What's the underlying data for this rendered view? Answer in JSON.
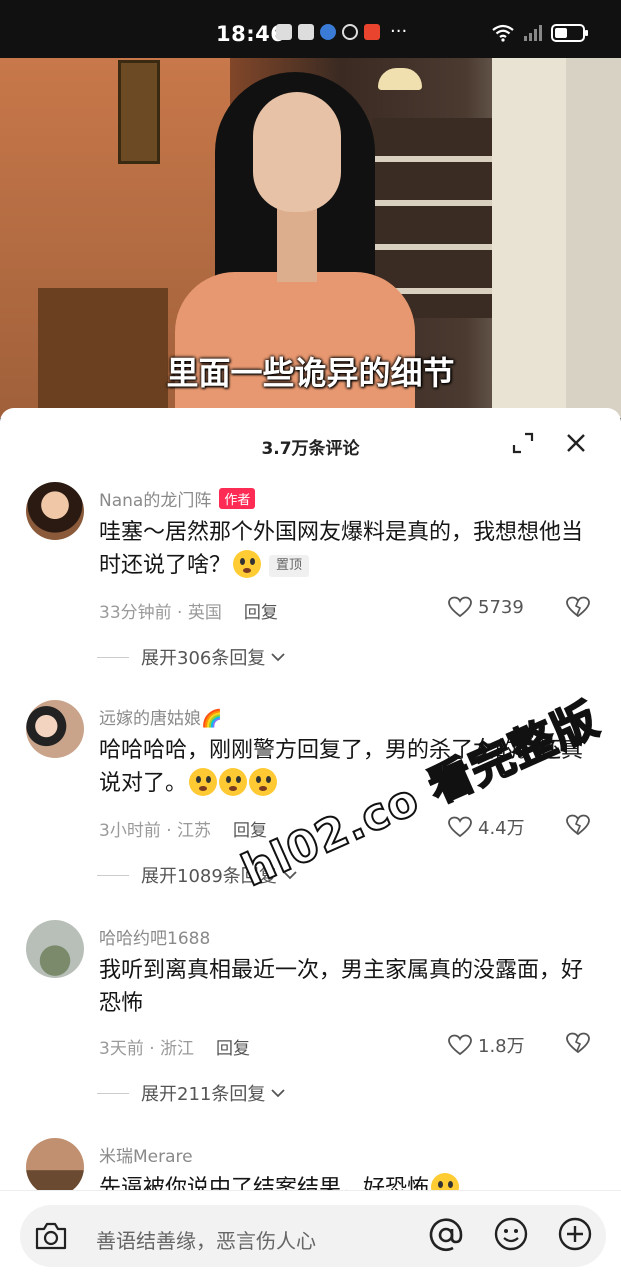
{
  "status_bar": {
    "time": "18:46",
    "more": "···"
  },
  "video": {
    "subtitle": "里面一些诡异的细节"
  },
  "sheet": {
    "title": "3.7万条评论"
  },
  "comments": [
    {
      "username": "Nana的龙门阵",
      "badge": "作者",
      "text": "哇塞～居然那个外国网友爆料是真的，我想想他当时还说了啥？",
      "pin": "置顶",
      "time_location": "33分钟前 · 英国",
      "reply": "回复",
      "likes": "5739",
      "expand": "展开306条回复"
    },
    {
      "username": "远嫁的唐姑娘🌈",
      "text": "哈哈哈哈，刚刚警方回复了，男的杀了女的。还真说对了。",
      "time_location": "3小时前 · 江苏",
      "reply": "回复",
      "likes": "4.4万",
      "expand": "展开1089条回复"
    },
    {
      "username": "哈哈约吧1688",
      "text": "我听到离真相最近一次，男主家属真的没露面，好恐怖",
      "time_location": "3天前 · 浙江",
      "reply": "回复",
      "likes": "1.8万",
      "expand": "展开211条回复"
    },
    {
      "username": "米瑞Merare",
      "text": "先逼被你说中了结案结果，好恐怖"
    }
  ],
  "watermark": "hl02.co 看完整版",
  "input": {
    "placeholder": "善语结善缘，恶言伤人心"
  },
  "colors": {
    "accent": "#fe2c55",
    "text": "#161616",
    "muted": "#8a8a8a"
  }
}
